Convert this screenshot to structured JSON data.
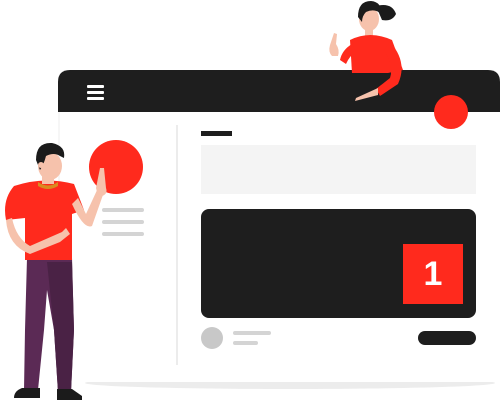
{
  "colors": {
    "accent": "#ff2a1d",
    "dark": "#1e1e1e",
    "panel": "#f5f5f5",
    "light_gray": "#e9e9e9",
    "mid_gray": "#c8c8c8",
    "pants": "#5b2a55",
    "skin": "#f6c2ac",
    "hair": "#1b1b1b"
  },
  "card": {
    "badge_number": "1"
  },
  "icons": {
    "menu": "hamburger-menu-icon",
    "avatar": "avatar-circle-icon"
  }
}
